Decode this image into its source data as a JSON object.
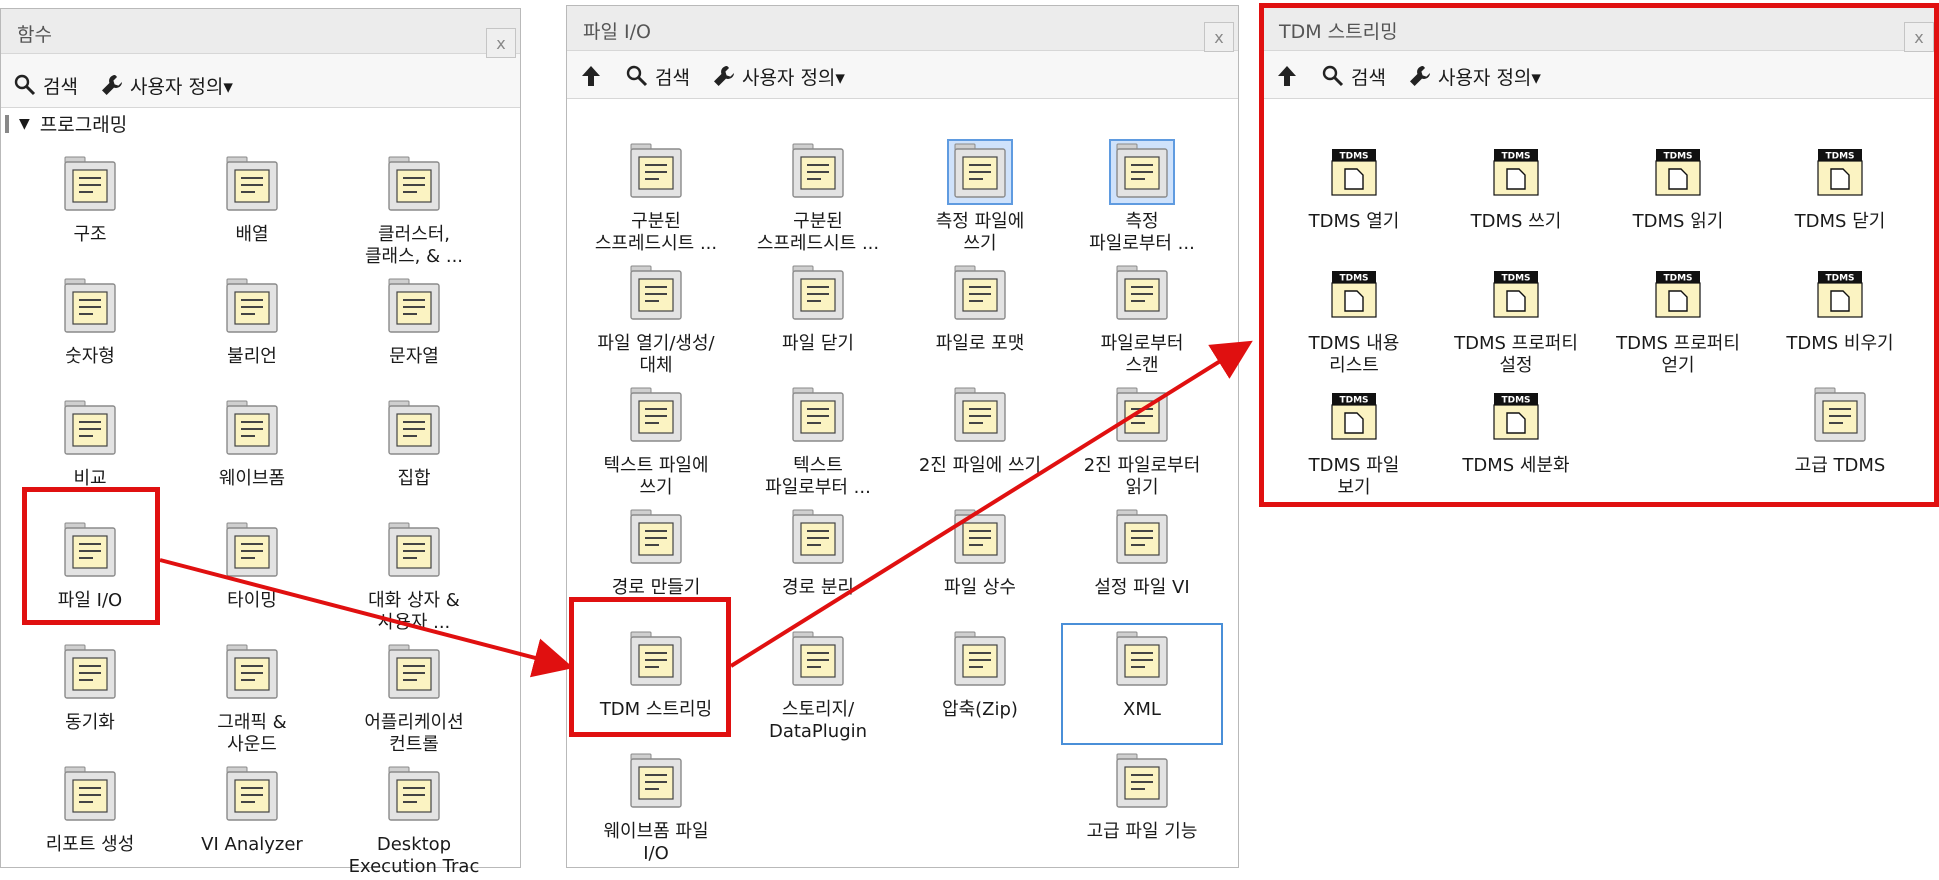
{
  "panels": {
    "functions": {
      "title": "함수",
      "close": "x",
      "toolbar": {
        "search": "검색",
        "customize": "사용자 정의▾"
      },
      "section": "프로그래밍",
      "items": [
        {
          "label": "구조",
          "icon": "structures-icon"
        },
        {
          "label": "배열",
          "icon": "array-icon"
        },
        {
          "label": "클러스터,\n클래스, & ...",
          "icon": "cluster-class-icon"
        },
        {
          "label": "숫자형",
          "icon": "numeric-icon"
        },
        {
          "label": "불리언",
          "icon": "boolean-icon"
        },
        {
          "label": "문자열",
          "icon": "string-icon"
        },
        {
          "label": "비교",
          "icon": "comparison-icon"
        },
        {
          "label": "웨이브폼",
          "icon": "waveform-icon"
        },
        {
          "label": "집합",
          "icon": "set-icon"
        },
        {
          "label": "파일 I/O",
          "icon": "file-io-icon"
        },
        {
          "label": "타이밍",
          "icon": "timing-icon"
        },
        {
          "label": "대화 상자 &\n사용자 ...",
          "icon": "dialog-user-interface-icon"
        },
        {
          "label": "동기화",
          "icon": "synchronization-icon"
        },
        {
          "label": "그래픽 &\n사운드",
          "icon": "graphics-sound-icon"
        },
        {
          "label": "어플리케이션\n컨트롤",
          "icon": "application-control-icon"
        },
        {
          "label": "리포트 생성",
          "icon": "report-generation-icon"
        },
        {
          "label": "VI Analyzer",
          "icon": "vi-analyzer-icon"
        },
        {
          "label": "Desktop\nExecution Trac",
          "icon": "desktop-execution-trace-icon"
        }
      ]
    },
    "fileio": {
      "title": "파일 I/O",
      "close": "x",
      "toolbar": {
        "search": "검색",
        "customize": "사용자 정의▾"
      },
      "items": [
        {
          "label": "구분된\n스프레드시트 ...",
          "icon": "write-delimited-spreadsheet-icon"
        },
        {
          "label": "구분된\n스프레드시트 ...",
          "icon": "read-delimited-spreadsheet-icon"
        },
        {
          "label": "측정 파일에\n쓰기",
          "icon": "write-measurement-file-icon"
        },
        {
          "label": "측정\n파일로부터 ...",
          "icon": "read-measurement-file-icon"
        },
        {
          "label": "파일 열기/생성/\n대체",
          "icon": "open-create-replace-file-icon"
        },
        {
          "label": "파일 닫기",
          "icon": "close-file-icon"
        },
        {
          "label": "파일로 포맷",
          "icon": "format-into-file-icon"
        },
        {
          "label": "파일로부터\n스캔",
          "icon": "scan-from-file-icon"
        },
        {
          "label": "텍스트 파일에\n쓰기",
          "icon": "write-text-file-icon"
        },
        {
          "label": "텍스트\n파일로부터 ...",
          "icon": "read-text-file-icon"
        },
        {
          "label": "2진 파일에 쓰기",
          "icon": "write-binary-file-icon"
        },
        {
          "label": "2진 파일로부터\n읽기",
          "icon": "read-binary-file-icon"
        },
        {
          "label": "경로 만들기",
          "icon": "build-path-icon"
        },
        {
          "label": "경로 분리",
          "icon": "strip-path-icon"
        },
        {
          "label": "파일 상수",
          "icon": "file-constants-icon"
        },
        {
          "label": "설정 파일 VI",
          "icon": "config-file-vi-icon"
        },
        {
          "label": "TDM 스트리밍",
          "icon": "tdm-streaming-icon"
        },
        {
          "label": "스토리지/\nDataPlugin",
          "icon": "storage-dataplugin-icon"
        },
        {
          "label": "압축(Zip)",
          "icon": "zip-icon"
        },
        {
          "label": "XML",
          "icon": "xml-icon"
        },
        {
          "label": "웨이브폼 파일\nI/O",
          "icon": "waveform-file-io-icon"
        },
        {
          "label": "",
          "icon": ""
        },
        {
          "label": "",
          "icon": ""
        },
        {
          "label": "고급 파일 기능",
          "icon": "advanced-file-functions-icon"
        }
      ]
    },
    "tdms": {
      "title": "TDM 스트리밍",
      "close": "x",
      "toolbar": {
        "search": "검색",
        "customize": "사용자 정의▾"
      },
      "items": [
        {
          "label": "TDMS 열기",
          "icon": "tdms-open-icon"
        },
        {
          "label": "TDMS 쓰기",
          "icon": "tdms-write-icon"
        },
        {
          "label": "TDMS 읽기",
          "icon": "tdms-read-icon"
        },
        {
          "label": "TDMS 닫기",
          "icon": "tdms-close-icon"
        },
        {
          "label": "TDMS 내용\n리스트",
          "icon": "tdms-list-contents-icon"
        },
        {
          "label": "TDMS 프로퍼티\n설정",
          "icon": "tdms-set-properties-icon"
        },
        {
          "label": "TDMS 프로퍼티\n얻기",
          "icon": "tdms-get-properties-icon"
        },
        {
          "label": "TDMS 비우기",
          "icon": "tdms-flush-icon"
        },
        {
          "label": "TDMS 파일\n보기",
          "icon": "tdms-file-viewer-icon"
        },
        {
          "label": "TDMS 세분화",
          "icon": "tdms-defragment-icon"
        },
        {
          "label": "",
          "icon": ""
        },
        {
          "label": "고급 TDMS",
          "icon": "advanced-tdms-icon"
        }
      ]
    }
  },
  "icon_badge": "TDMS",
  "colors": {
    "highlight": "#e01010",
    "selection": "#4a8fd8",
    "icon_face": "#fbf3c2"
  }
}
